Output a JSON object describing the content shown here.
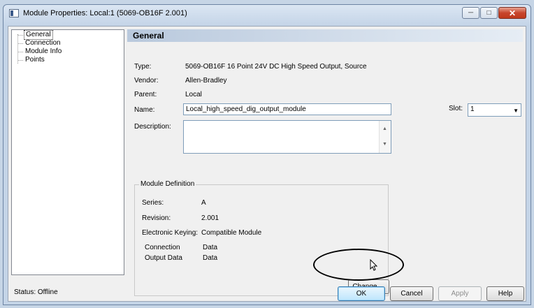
{
  "window": {
    "title": "Module Properties: Local:1 (5069-OB16F 2.001)",
    "controls": {
      "minimize_icon": "minimize-icon",
      "maximize_icon": "maximize-icon",
      "close_icon": "close-icon"
    }
  },
  "tree": {
    "items": [
      {
        "label": "General",
        "selected": true
      },
      {
        "label": "Connection",
        "selected": false
      },
      {
        "label": "Module Info",
        "selected": false
      },
      {
        "label": "Points",
        "selected": false
      }
    ]
  },
  "general": {
    "header": "General",
    "type_label": "Type:",
    "type_value": "5069-OB16F 16 Point 24V DC High Speed Output, Source",
    "vendor_label": "Vendor:",
    "vendor_value": "Allen-Bradley",
    "parent_label": "Parent:",
    "parent_value": "Local",
    "name_label": "Name:",
    "name_value": "Local_high_speed_dig_output_module",
    "description_label": "Description:",
    "description_value": "",
    "slot_label": "Slot:",
    "slot_value": "1"
  },
  "module_definition": {
    "title": "Module Definition",
    "series_label": "Series:",
    "series_value": "A",
    "revision_label": "Revision:",
    "revision_value": "2.001",
    "keying_label": "Electronic Keying:",
    "keying_value": "Compatible Module",
    "connection_label": "Connection",
    "connection_value": "Data",
    "output_label": "Output Data",
    "output_value": "Data",
    "change_button": "Change ..."
  },
  "footer": {
    "status": "Status:  Offline",
    "ok": "OK",
    "cancel": "Cancel",
    "apply": "Apply",
    "help": "Help"
  },
  "colors": {
    "accent": "#3c7fb1",
    "close": "#c7452c",
    "header_gradient_start": "#b9c9dd"
  }
}
